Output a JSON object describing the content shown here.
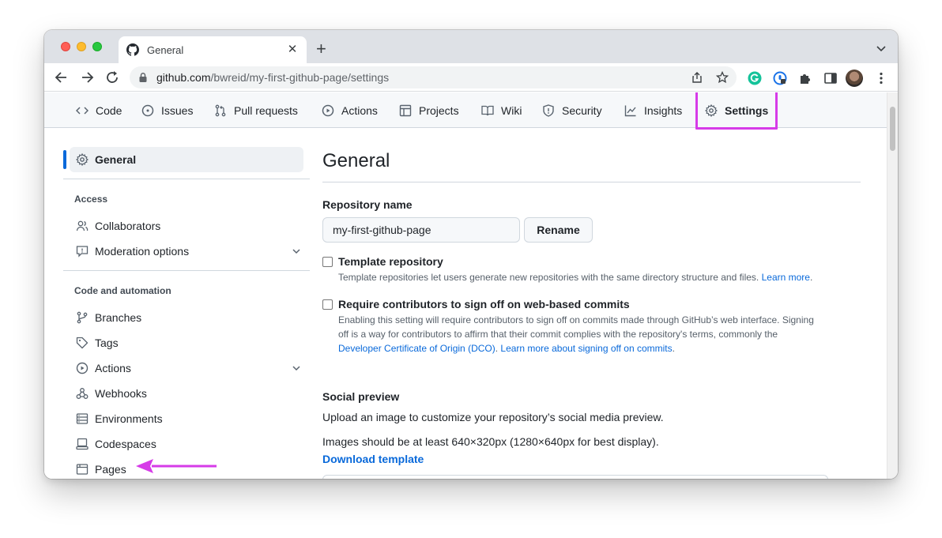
{
  "browser": {
    "tab_title": "General",
    "url_host": "github.com",
    "url_path": "/bwreid/my-first-github-page/settings"
  },
  "repo_nav": {
    "items": [
      {
        "label": "Code",
        "icon": "code-icon"
      },
      {
        "label": "Issues",
        "icon": "issue-icon"
      },
      {
        "label": "Pull requests",
        "icon": "pull-request-icon"
      },
      {
        "label": "Actions",
        "icon": "actions-play-icon"
      },
      {
        "label": "Projects",
        "icon": "table-icon"
      },
      {
        "label": "Wiki",
        "icon": "book-icon"
      },
      {
        "label": "Security",
        "icon": "shield-icon"
      },
      {
        "label": "Insights",
        "icon": "graph-icon"
      },
      {
        "label": "Settings",
        "icon": "gear-icon",
        "active": true
      }
    ]
  },
  "sidebar": {
    "general": "General",
    "access_heading": "Access",
    "access_items": [
      "Collaborators",
      "Moderation options"
    ],
    "code_heading": "Code and automation",
    "code_items": [
      "Branches",
      "Tags",
      "Actions",
      "Webhooks",
      "Environments",
      "Codespaces",
      "Pages"
    ]
  },
  "main": {
    "title": "General",
    "repo_name_label": "Repository name",
    "repo_name_value": "my-first-github-page",
    "rename_button": "Rename",
    "template": {
      "title": "Template repository",
      "desc": "Template repositories let users generate new repositories with the same directory structure and files.",
      "link": "Learn more"
    },
    "signoff": {
      "title": "Require contributors to sign off on web-based commits",
      "desc_line1": "Enabling this setting will require contributors to sign off on commits made through GitHub’s web interface. Signing",
      "desc_line2": "off is a way for contributors to affirm that their commit complies with the repository's terms, commonly the",
      "link1": "Developer Certificate of Origin (DCO)",
      "link2": "Learn more about signing off on commits"
    },
    "social": {
      "heading": "Social preview",
      "line1": "Upload an image to customize your repository’s social media preview.",
      "line2": "Images should be at least 640×320px (1280×640px for best display).",
      "download": "Download template"
    }
  },
  "colors": {
    "highlight": "#d63be8",
    "accent": "#0969da"
  }
}
